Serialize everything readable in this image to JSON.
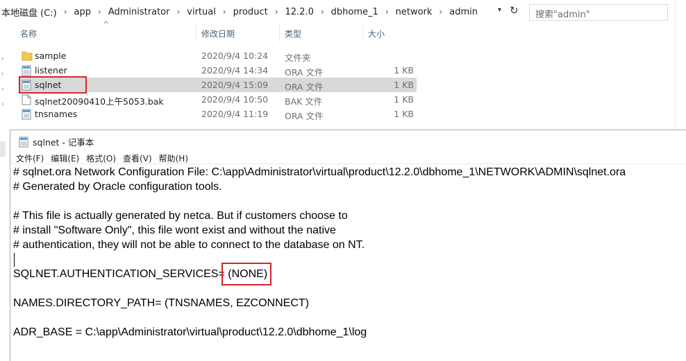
{
  "address": {
    "crumbs": [
      "本地磁盘 (C:)",
      "app",
      "Administrator",
      "virtual",
      "product",
      "12.2.0",
      "dbhome_1",
      "network",
      "admin"
    ],
    "search_placeholder": "搜索\"admin\""
  },
  "columns": {
    "name": "名称",
    "date": "修改日期",
    "type": "类型",
    "size": "大小"
  },
  "files": [
    {
      "name": "sample",
      "date": "2020/9/4 10:24",
      "type": "文件夹",
      "size": "",
      "icon": "folder-icon"
    },
    {
      "name": "listener",
      "date": "2020/9/4 14:34",
      "type": "ORA 文件",
      "size": "1 KB",
      "icon": "ora-file-icon"
    },
    {
      "name": "sqlnet",
      "date": "2020/9/4 15:09",
      "type": "ORA 文件",
      "size": "1 KB",
      "icon": "ora-file-icon",
      "selected": true
    },
    {
      "name": "sqlnet20090410上午5053.bak",
      "date": "2020/9/4 10:50",
      "type": "BAK 文件",
      "size": "1 KB",
      "icon": "blank-file-icon"
    },
    {
      "name": "tnsnames",
      "date": "2020/9/4 11:19",
      "type": "ORA 文件",
      "size": "1 KB",
      "icon": "ora-file-icon"
    }
  ],
  "notepad": {
    "title": "sqlnet - 记事本",
    "menu": [
      "文件(F)",
      "编辑(E)",
      "格式(O)",
      "查看(V)",
      "帮助(H)"
    ],
    "lines": [
      "# sqlnet.ora Network Configuration File: C:\\app\\Administrator\\virtual\\product\\12.2.0\\dbhome_1\\NETWORK\\ADMIN\\sqlnet.ora",
      "# Generated by Oracle configuration tools.",
      "",
      "# This file is actually generated by netca. But if customers choose to",
      "# install \"Software Only\", this file wont exist and without the native",
      "# authentication, they will not be able to connect to the database on NT.",
      "",
      "SQLNET.AUTHENTICATION_SERVICES= (NONE)",
      "",
      "NAMES.DIRECTORY_PATH= (TNSNAMES, EZCONNECT)",
      "",
      "ADR_BASE = C:\\app\\Administrator\\virtual\\product\\12.2.0\\dbhome_1\\log"
    ],
    "auth_key": "SQLNET.AUTHENTICATION_SERVICES=",
    "auth_value": "(NONE)"
  },
  "colors": {
    "highlight": "#d9232b",
    "selected_row": "#d9d9d9",
    "header_text": "#4c607a"
  }
}
